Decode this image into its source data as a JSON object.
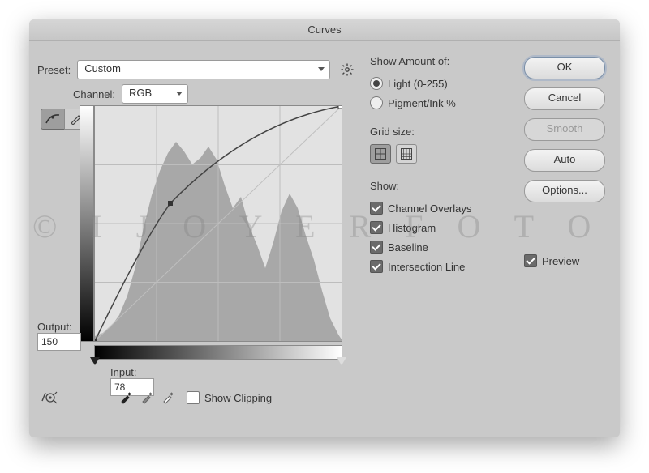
{
  "dialog": {
    "title": "Curves"
  },
  "preset": {
    "label": "Preset:",
    "value": "Custom"
  },
  "channel": {
    "label": "Channel:",
    "value": "RGB"
  },
  "output": {
    "label": "Output:",
    "value": "150"
  },
  "input": {
    "label": "Input:",
    "value": "78"
  },
  "show_clipping": {
    "label": "Show Clipping",
    "checked": false
  },
  "show_amount": {
    "title": "Show Amount of:",
    "options": [
      {
        "label": "Light  (0-255)",
        "selected": true
      },
      {
        "label": "Pigment/Ink %",
        "selected": false
      }
    ]
  },
  "grid_size": {
    "title": "Grid size:",
    "selected": "4x4"
  },
  "show": {
    "title": "Show:",
    "items": [
      {
        "label": "Channel Overlays",
        "checked": true
      },
      {
        "label": "Histogram",
        "checked": true
      },
      {
        "label": "Baseline",
        "checked": true
      },
      {
        "label": "Intersection Line",
        "checked": true
      }
    ]
  },
  "buttons": {
    "ok": "OK",
    "cancel": "Cancel",
    "smooth": "Smooth",
    "auto": "Auto",
    "options": "Options..."
  },
  "preview": {
    "label": "Preview",
    "checked": true
  },
  "watermark": "© I J O Y E R F O T O",
  "icons": {
    "gear": "gear-icon",
    "curve_tool": "curve-tool-icon",
    "pencil": "pencil-icon",
    "target": "target-adjust-icon",
    "eyedropper_black": "eyedropper-black-icon",
    "eyedropper_gray": "eyedropper-gray-icon",
    "eyedropper_white": "eyedropper-white-icon",
    "grid4": "grid-4x4-icon",
    "grid10": "grid-10x10-icon"
  },
  "chart_data": {
    "type": "line",
    "title": "Curves",
    "xlabel": "Input",
    "ylabel": "Output",
    "xlim": [
      0,
      255
    ],
    "ylim": [
      0,
      255
    ],
    "series": [
      {
        "name": "curve",
        "x": [
          0,
          78,
          255
        ],
        "y": [
          0,
          150,
          255
        ]
      },
      {
        "name": "baseline",
        "x": [
          0,
          255
        ],
        "y": [
          0,
          255
        ]
      }
    ],
    "selected_point": {
      "input": 78,
      "output": 150
    },
    "histogram_shape": [
      0,
      2,
      5,
      9,
      15,
      24,
      40,
      62,
      78,
      90,
      96,
      92,
      84,
      88,
      94,
      86,
      70,
      58,
      64,
      50,
      40,
      30,
      44,
      60,
      70,
      62,
      48,
      36,
      22,
      10,
      4,
      1
    ]
  }
}
